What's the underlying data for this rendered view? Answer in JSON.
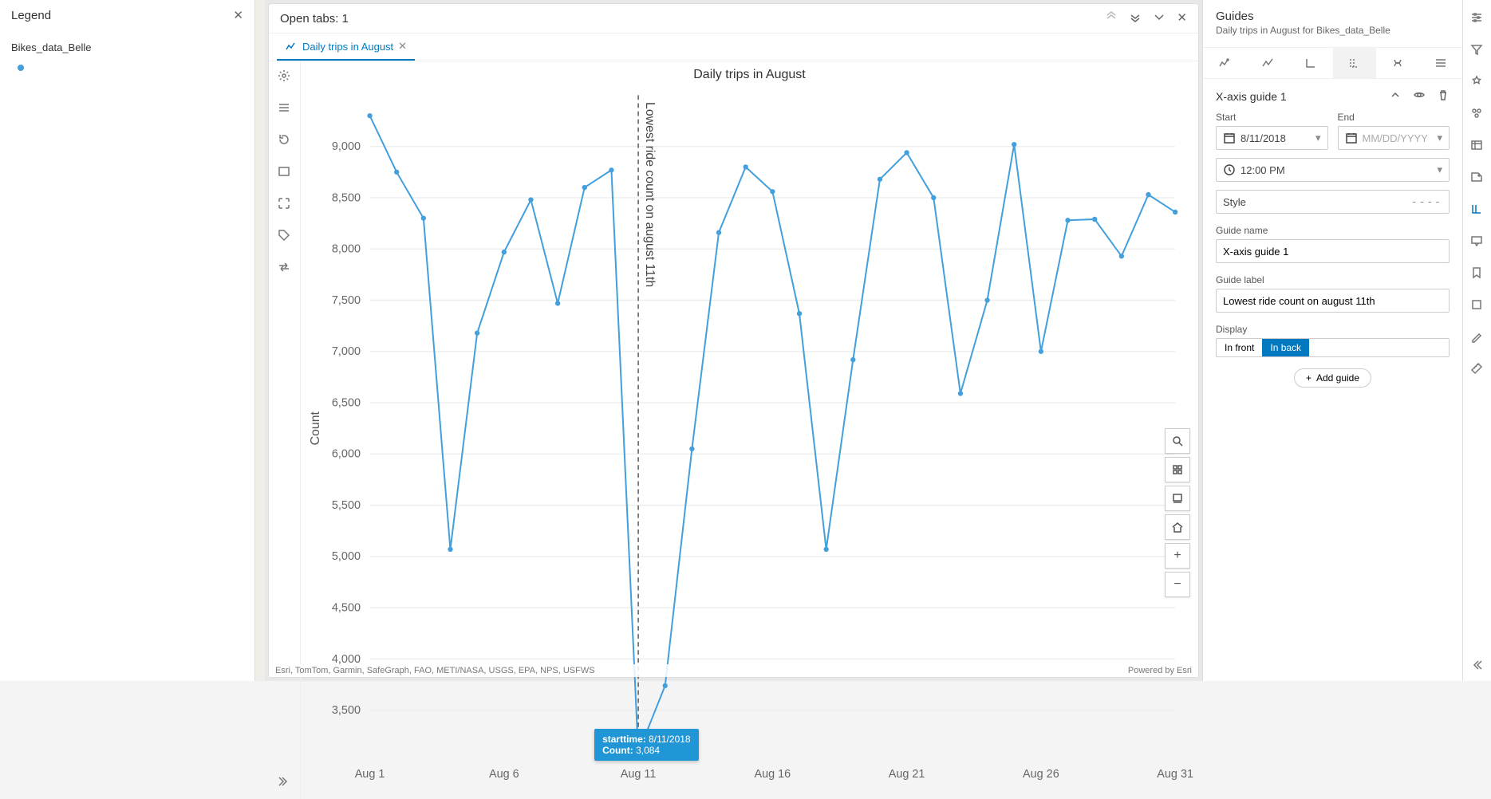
{
  "legend": {
    "title": "Legend",
    "layers": [
      "Bikes_data_Belle"
    ]
  },
  "pane": {
    "open_tabs_label": "Open tabs: 1",
    "tab_label": "Daily trips in August"
  },
  "chart_data": {
    "type": "line",
    "title": "Daily trips in August",
    "xlabel": "",
    "ylabel": "Count",
    "x_ticks": [
      "Aug 1",
      "Aug 6",
      "Aug 11",
      "Aug 16",
      "Aug 21",
      "Aug 26",
      "Aug 31"
    ],
    "ylim": [
      3000,
      9500
    ],
    "y_ticks": [
      3500,
      4000,
      4500,
      5000,
      5500,
      6000,
      6500,
      7000,
      7500,
      8000,
      8500,
      9000
    ],
    "categories": [
      "8/1/2018",
      "8/2/2018",
      "8/3/2018",
      "8/4/2018",
      "8/5/2018",
      "8/6/2018",
      "8/7/2018",
      "8/8/2018",
      "8/9/2018",
      "8/10/2018",
      "8/11/2018",
      "8/12/2018",
      "8/13/2018",
      "8/14/2018",
      "8/15/2018",
      "8/16/2018",
      "8/17/2018",
      "8/18/2018",
      "8/19/2018",
      "8/20/2018",
      "8/21/2018",
      "8/22/2018",
      "8/23/2018",
      "8/24/2018",
      "8/25/2018",
      "8/26/2018",
      "8/27/2018",
      "8/28/2018",
      "8/29/2018",
      "8/30/2018",
      "8/31/2018"
    ],
    "series": [
      {
        "name": "Count",
        "values": [
          9300,
          8750,
          8300,
          5070,
          7180,
          7970,
          8480,
          7470,
          8600,
          8770,
          3084,
          3740,
          6050,
          8160,
          8800,
          8560,
          7370,
          5070,
          6920,
          8680,
          8940,
          8500,
          6590,
          7500,
          9020,
          7000,
          8280,
          8290,
          7930,
          8530,
          8360
        ]
      }
    ],
    "guide": {
      "x_category": "8/11/2018",
      "label": "Lowest ride count on august 11th"
    },
    "tooltip": {
      "starttime_label": "starttime:",
      "starttime_value": "8/11/2018",
      "count_label": "Count:",
      "count_value": "3,084"
    }
  },
  "guides_panel": {
    "title": "Guides",
    "subtitle": "Daily trips in August for Bikes_data_Belle",
    "guide_header": "X-axis guide 1",
    "start_label": "Start",
    "end_label": "End",
    "start_value": "8/11/2018",
    "end_placeholder": "MM/DD/YYYY",
    "time_value": "12:00 PM",
    "style_label": "Style",
    "style_value": "----",
    "name_label": "Guide name",
    "name_value": "X-axis guide 1",
    "label_label": "Guide label",
    "label_value": "Lowest ride count on august 11th",
    "display_label": "Display",
    "display_front": "In front",
    "display_back": "In back",
    "add_guide": "Add guide"
  },
  "map": {
    "attribution": "Esri, TomTom, Garmin, SafeGraph, FAO, METI/NASA, USGS, EPA, NPS, USFWS",
    "powered": "Powered by Esri"
  }
}
